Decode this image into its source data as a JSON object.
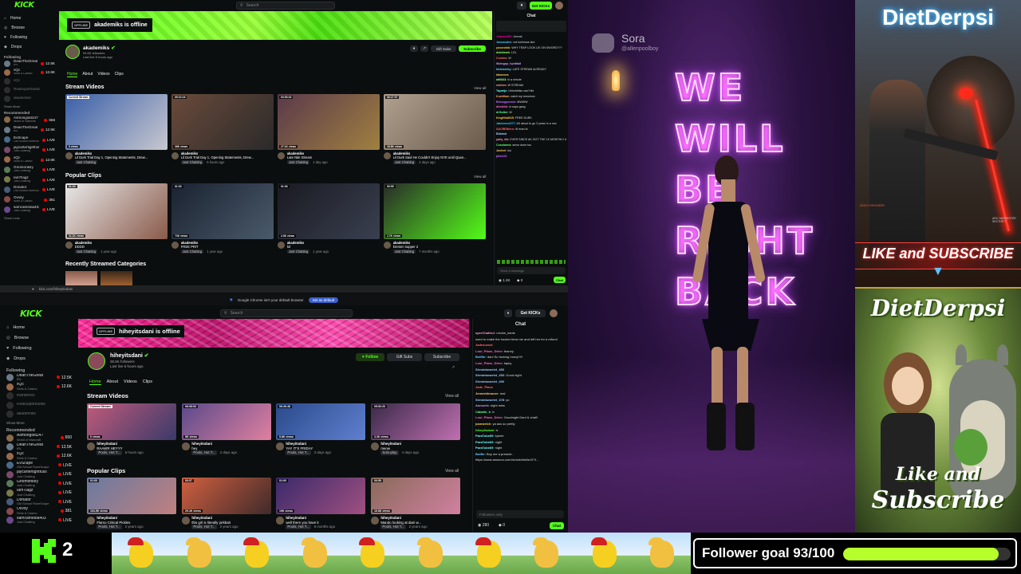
{
  "top_kick": {
    "logo": "KICK",
    "search_placeholder": "Search",
    "get_kicks": "Get KICKs",
    "nav": [
      "Home",
      "Browse",
      "Following",
      "Drops"
    ],
    "following_head": "Following",
    "following": [
      {
        "name": "DeanTheGreat",
        "game": "IRL",
        "viewers": "12.5K",
        "color": "#6a7a8a"
      },
      {
        "name": "xQc",
        "game": "Slots & Casino",
        "viewers": "12.6K",
        "color": "#9a6a4a"
      },
      {
        "name": "xQc",
        "game": "",
        "viewers": "",
        "color": "#555"
      },
      {
        "name": "Realsuperbuilds",
        "game": "",
        "viewers": "",
        "color": "#555"
      },
      {
        "name": "akademiks",
        "game": "",
        "viewers": "",
        "color": "#555"
      }
    ],
    "show_more": "Show More",
    "recommended_head": "Recommended",
    "recommended": [
      {
        "name": "Asmongold247",
        "game": "World of Warcraft",
        "viewers": "656",
        "color": "#8a6a4a"
      },
      {
        "name": "DeanTheGreat",
        "game": "IRL",
        "viewers": "12.5K",
        "color": "#6a7a8a"
      },
      {
        "name": "EvScape",
        "game": "Old School RuneScape",
        "viewers": "LIVE",
        "color": "#4a6a8a"
      },
      {
        "name": "jaycartertightfuss",
        "game": "Just Chatting",
        "viewers": "LIVE",
        "color": "#7a4a6a"
      },
      {
        "name": "xQc",
        "game": "Slots & Casino",
        "viewers": "12.6K",
        "color": "#9a6a4a"
      },
      {
        "name": "Gnomonkey",
        "game": "Just Chatting",
        "viewers": "LIVE",
        "color": "#5a7a5a"
      },
      {
        "name": "IamTiagz",
        "game": "Just Chatting",
        "viewers": "LIVE",
        "color": "#7a7a4a"
      },
      {
        "name": "Donator",
        "game": "Old School RuneScape",
        "viewers": "LIVE",
        "color": "#4a5a7a"
      },
      {
        "name": "Ovvsy",
        "game": "Slots & Casino",
        "viewers": "381",
        "color": "#8a4a4a"
      },
      {
        "name": "samcamedia403",
        "game": "Just Chatting",
        "viewers": "LIVE",
        "color": "#6a4a8a"
      }
    ],
    "show_less": "Show Less",
    "banner_offline": "OFFLINE",
    "banner_text": "akademiks is offline",
    "channel_name": "akademiks",
    "followers": "94.6K followers",
    "last_live": "Last live 5 hours ago",
    "gift_subs": "Gift Subs",
    "subscribe": "Subscribe",
    "tabs": [
      "Home",
      "About",
      "Videos",
      "Clips"
    ],
    "stream_videos_title": "Stream Videos",
    "view_all": "View all",
    "videos": [
      {
        "tag": "Current Stream",
        "views": "0 views",
        "title": "Lil Durk Trial Day 1, Opening Statements, Drew...",
        "cat": "Just Chatting",
        "age": "",
        "c1": "#3a5fa8",
        "c2": "#c8c8d0"
      },
      {
        "tag": "05:22:16",
        "views": "38K views",
        "title": "Lil Durk Trial Day 1, Opening Statements, Drew...",
        "cat": "Just Chatting",
        "age": "5 hours ago",
        "c1": "#6a4a3a",
        "c2": "#2a2a2a"
      },
      {
        "tag": "03:53:32",
        "views": "27.1K views",
        "title": "Late Nite Stream",
        "cat": "Just Chatting",
        "age": "1 day ago",
        "c1": "#5a3a4a",
        "c2": "#a08040"
      },
      {
        "tag": "06:27:57",
        "views": "28.5K views",
        "title": "Lil Durk Said He Couldn't Enjoy NYE until Quan...",
        "cat": "Just Chatting",
        "age": "4 days ago",
        "c1": "#b0a090",
        "c2": "#6a5a4a"
      }
    ],
    "popular_clips_title": "Popular Clips",
    "clips": [
      {
        "tag": "01:00",
        "views": "41.1K views",
        "title": "DDDD",
        "cat": "Just Chatting",
        "age": "1 year ago",
        "c1": "#e8e8e8",
        "c2": "#8a5a4a"
      },
      {
        "tag": "01:00",
        "views": "73K views",
        "title": "FREE PRIT",
        "cat": "Just Chatting",
        "age": "1 year ago",
        "c1": "#1a2230",
        "c2": "#4a5a6a"
      },
      {
        "tag": "01:00",
        "views": "2.3K views",
        "title": "lol",
        "cat": "Just Chatting",
        "age": "1 year ago",
        "c1": "#1a1a22",
        "c2": "#3a4050"
      },
      {
        "tag": "00:59",
        "views": "1.7K views",
        "title": "kremen supper 2",
        "cat": "Just Chatting",
        "age": "7 months ago",
        "c1": "#2a2a2a",
        "c2": "#53fc18"
      }
    ],
    "recent_categories_title": "Recently Streamed Categories",
    "chat_title": "Chat",
    "chat_lines": [
      {
        "user": "Jsmoon001",
        "color": "#f0a",
        "msg": "Unreal"
      },
      {
        "user": "Jaxswoden",
        "color": "#3cf",
        "msg": "not luminose slut"
      },
      {
        "user": "yoxorolnb",
        "color": "#fc3",
        "msg": "WHY TRAP LOOK LIE ON SWORD???"
      },
      {
        "user": "dobblewb",
        "color": "#9f6",
        "msg": "LOL"
      },
      {
        "user": "Coolmo",
        "color": "#f66",
        "msg": "W"
      },
      {
        "user": "Wolngop_hpnMalt",
        "color": "#c9f",
        "msg": ""
      },
      {
        "user": "kickrastley",
        "color": "#6cf",
        "msg": "LATE STREAM ALREADY"
      },
      {
        "user": "lakonoes",
        "color": "#fc6",
        "msg": ""
      },
      {
        "user": "alt0843",
        "color": "#9f9",
        "msg": "in a minute"
      },
      {
        "user": "ndelsm",
        "color": "#f99",
        "msg": "W STREAM"
      },
      {
        "user": "Taymijn",
        "color": "#6ff",
        "msg": "Uhhuhbliss can't fini"
      },
      {
        "user": "Kushflam",
        "color": "#fa6",
        "msg": "catch my tomorrow"
      },
      {
        "user": "Bishoppmmm",
        "color": "#c6f",
        "msg": "WWWW"
      },
      {
        "user": "dleokikk",
        "color": "#f6c",
        "msg": "le says gang"
      },
      {
        "user": "drGutter",
        "color": "#6f9",
        "msg": "W"
      },
      {
        "user": "KingHidd015",
        "color": "#fc3",
        "msg": "FREE DURK"
      },
      {
        "user": "Jatcheso2277",
        "color": "#3cf",
        "msg": "AK about to go 3 years in a row"
      },
      {
        "user": "SACRENtero",
        "color": "#f66",
        "msg": "W eran.ht"
      },
      {
        "user": "Bilatmd",
        "color": "#9cf",
        "msg": ""
      },
      {
        "user": "yarly_kik",
        "color": "#f9c",
        "msg": "EVER SINCE AK GOT THE 1K MONTHLY ALLOWANCE DAPHNE JOY"
      },
      {
        "user": "Cosolanna",
        "color": "#6f6",
        "msg": "serve done too"
      },
      {
        "user": "Jueleel",
        "color": "#fc6",
        "msg": "too"
      },
      {
        "user": "jdoh101",
        "color": "#c6f",
        "msg": ""
      }
    ],
    "chat_placeholder": "Send a message",
    "chat_viewers": "1.2K",
    "chat_count": "0",
    "chat_btn": "Chat"
  },
  "bottom_kick": {
    "url": "kick.com/hiheyitsdani",
    "chrome_msg": "Google Chrome isn't your default browser",
    "chrome_btn": "Set as default",
    "logo": "KICK",
    "search_placeholder": "Search",
    "get_kicks": "Get KICKs",
    "nav": [
      "Home",
      "Browse",
      "Following",
      "Drops"
    ],
    "following_head": "Following",
    "following": [
      {
        "name": "DeanTheGreat",
        "game": "IRL",
        "viewers": "12.5K",
        "color": "#6a7a8a"
      },
      {
        "name": "xQc",
        "game": "Slots & Casino",
        "viewers": "12.6K",
        "color": "#9a6a4a"
      },
      {
        "name": "trainwreck",
        "game": "",
        "viewers": "",
        "color": "#555"
      },
      {
        "name": "Realsuperbuilds",
        "game": "",
        "viewers": "",
        "color": "#555"
      },
      {
        "name": "akademiks",
        "game": "",
        "viewers": "",
        "color": "#555"
      }
    ],
    "show_more": "Show More",
    "recommended_head": "Recommended",
    "recommended": [
      {
        "name": "Asmongold247",
        "game": "World of Warcraft",
        "viewers": "650",
        "color": "#8a6a4a"
      },
      {
        "name": "DeanTheGreat",
        "game": "IRL",
        "viewers": "12.5K",
        "color": "#6a7a8a"
      },
      {
        "name": "xQc",
        "game": "Slots & Casino",
        "viewers": "12.6K",
        "color": "#9a6a4a"
      },
      {
        "name": "EvScape",
        "game": "Old School RuneScape",
        "viewers": "LIVE",
        "color": "#4a6a8a"
      },
      {
        "name": "jaycartertightfuss",
        "game": "Just Chatting",
        "viewers": "LIVE",
        "color": "#7a4a6a"
      },
      {
        "name": "Gnomonkey",
        "game": "Just Chatting",
        "viewers": "LIVE",
        "color": "#5a7a5a"
      },
      {
        "name": "IamTiagz",
        "game": "Just Chatting",
        "viewers": "LIVE",
        "color": "#7a7a4a"
      },
      {
        "name": "Donator",
        "game": "Old School RuneScape",
        "viewers": "LIVE",
        "color": "#4a5a7a"
      },
      {
        "name": "Ovvsy",
        "game": "Slots & Casino",
        "viewers": "381",
        "color": "#8a4a4a"
      },
      {
        "name": "samcamedia403",
        "game": "Just Chatting",
        "viewers": "LIVE",
        "color": "#6a4a8a"
      }
    ],
    "banner_offline": "OFFLINE",
    "banner_text": "hiheyitsdani is offline",
    "channel_name": "hiheyitsdani",
    "followers": "35.6K followers",
    "last_live": "Last live 6 hours ago",
    "follow": "Follow",
    "gift_subs": "Gift Subs",
    "subscribe": "Subscribe",
    "tabs": [
      "Home",
      "About",
      "Videos",
      "Clips"
    ],
    "stream_videos_title": "Stream Videos",
    "view_all": "View all",
    "videos": [
      {
        "tag": "Current Stream",
        "views": "0 views",
        "title": "RAAWR HEYYY",
        "cat": "Pools, Hot T...",
        "age": "6 hours ago",
        "c1": "#c05a7a",
        "c2": "#3a3a6a"
      },
      {
        "tag": "06:08:53",
        "views": "5K views",
        "title": "hey",
        "cat": "Pools, Hot T...",
        "age": "2 days ago",
        "c1": "#5a4a8a",
        "c2": "#e080a0"
      },
      {
        "tag": "06:26:48",
        "views": "5.8K views",
        "title": "YAY IT'S FRIDAY",
        "cat": "Pools, Hot T...",
        "age": "3 days ago",
        "c1": "#2a4a8a",
        "c2": "#6080d0"
      },
      {
        "tag": "05:52:20",
        "views": "3.3K views",
        "title": "meow",
        "cat": "Solo-play",
        "age": "4 days ago",
        "c1": "#3a2a4a",
        "c2": "#c070b0"
      }
    ],
    "popular_clips_title": "Popular Clips",
    "clips": [
      {
        "tag": "01:00",
        "views": "104.5K views",
        "title": "Flamo Critical Pickles",
        "cat": "Pools, Hot T...",
        "age": "2 years ago",
        "c1": "#6a7aa0",
        "c2": "#c08080"
      },
      {
        "tag": "00:57",
        "views": "29.4K views",
        "title": "this girl is literally jorkbait",
        "cat": "Pools, Hot T...",
        "age": "2 years ago",
        "c1": "#d06040",
        "c2": "#402a2a"
      },
      {
        "tag": "01:00",
        "views": "19K views",
        "title": "well there you have it",
        "cat": "Pools, Hot T...",
        "age": "5 months ago",
        "c1": "#3a2a6a",
        "c2": "#a05080"
      },
      {
        "tag": "00:59",
        "views": "16.8K views",
        "title": "Mando looking at dani w...",
        "cat": "Pools, Hot T...",
        "age": "2 years ago",
        "c1": "#8a6a5a",
        "c2": "#d080a0"
      }
    ],
    "chat_title": "Chat",
    "chat_lines": [
      {
        "user": "sperChat0xJ",
        "color": "#f9c",
        "msg": "rvecke_kanie"
      },
      {
        "user": "",
        "color": "#ddd",
        "msg": "used to make the hooker blow me and left her for a refund"
      },
      {
        "user": "Jadesuveal",
        "color": "#f66",
        "msg": ""
      },
      {
        "user": "Loui_Plans_Drive",
        "color": "#f6c",
        "msg": "thanny"
      },
      {
        "user": "Beltfkr",
        "color": "#6cf",
        "msg": "dani So fucking horny!!!!!"
      },
      {
        "user": "Loui_Plans_Drive",
        "color": "#f6c",
        "msg": "tapky"
      },
      {
        "user": "Sirminkwoelet_453",
        "color": "#9cf",
        "msg": ""
      },
      {
        "user": "Sirminkwoelet_453",
        "color": "#9cf",
        "msg": "Good night"
      },
      {
        "user": "Sirminkwoelet_453",
        "color": "#9cf",
        "msg": ""
      },
      {
        "user": "Jade_Plane",
        "color": "#f66",
        "msg": ""
      },
      {
        "user": "Jemeshtmoore",
        "color": "#fc6",
        "msg": "real"
      },
      {
        "user": "Sirminkwoelet_478",
        "color": "#9cf",
        "msg": "yo"
      },
      {
        "user": "Asnoeek",
        "color": "#c9f",
        "msg": "night miss"
      },
      {
        "user": "Caballo_k",
        "color": "#6f9",
        "msg": "lv"
      },
      {
        "user": "Loui_Plans_Drive",
        "color": "#f6c",
        "msg": "Goodnight Dani & chat!!"
      },
      {
        "user": "joanwelch",
        "color": "#fc3",
        "msg": "ya ass so pretty"
      },
      {
        "user": "hiheyitsdani",
        "color": "#53fc18",
        "msg": "lv"
      },
      {
        "user": "ParaTube69",
        "color": "#6ff",
        "msg": "byeee"
      },
      {
        "user": "ParaTube69",
        "color": "#6ff",
        "msg": "night"
      },
      {
        "user": "ParaTube69",
        "color": "#6ff",
        "msg": "night"
      },
      {
        "user": "Botfkr",
        "color": "#6cf",
        "msg": "Buy me a present.."
      },
      {
        "user": "",
        "color": "#ddd",
        "msg": "https://www.amazon.com/hz/wishlist/ls/1FX..."
      }
    ],
    "chat_placeholder": "Followers only",
    "chat_viewers": "280",
    "chat_count": "0",
    "chat_btn": "Chat"
  },
  "sora": {
    "brand": "Sora",
    "handle": "@allenpoolboy",
    "neon_lines": [
      "WE",
      "WILL",
      "BE",
      "RIGHT",
      "BACK"
    ]
  },
  "ads": {
    "top_title": "DietDerpsi",
    "top_cta": "LIKE and SUBSCRIBE",
    "top_small_left": "DEATH ENGINEER",
    "top_small_right": "ARC HARVESTER SECTOR 7",
    "bottom_title": "DietDerpsi",
    "bottom_cta_1": "Like and",
    "bottom_cta_2": "Subscribe"
  },
  "bottom_bar": {
    "kick_count": "2",
    "follower_goal_label": "Follower goal 93/100",
    "goal_current": 93,
    "goal_total": 100
  }
}
